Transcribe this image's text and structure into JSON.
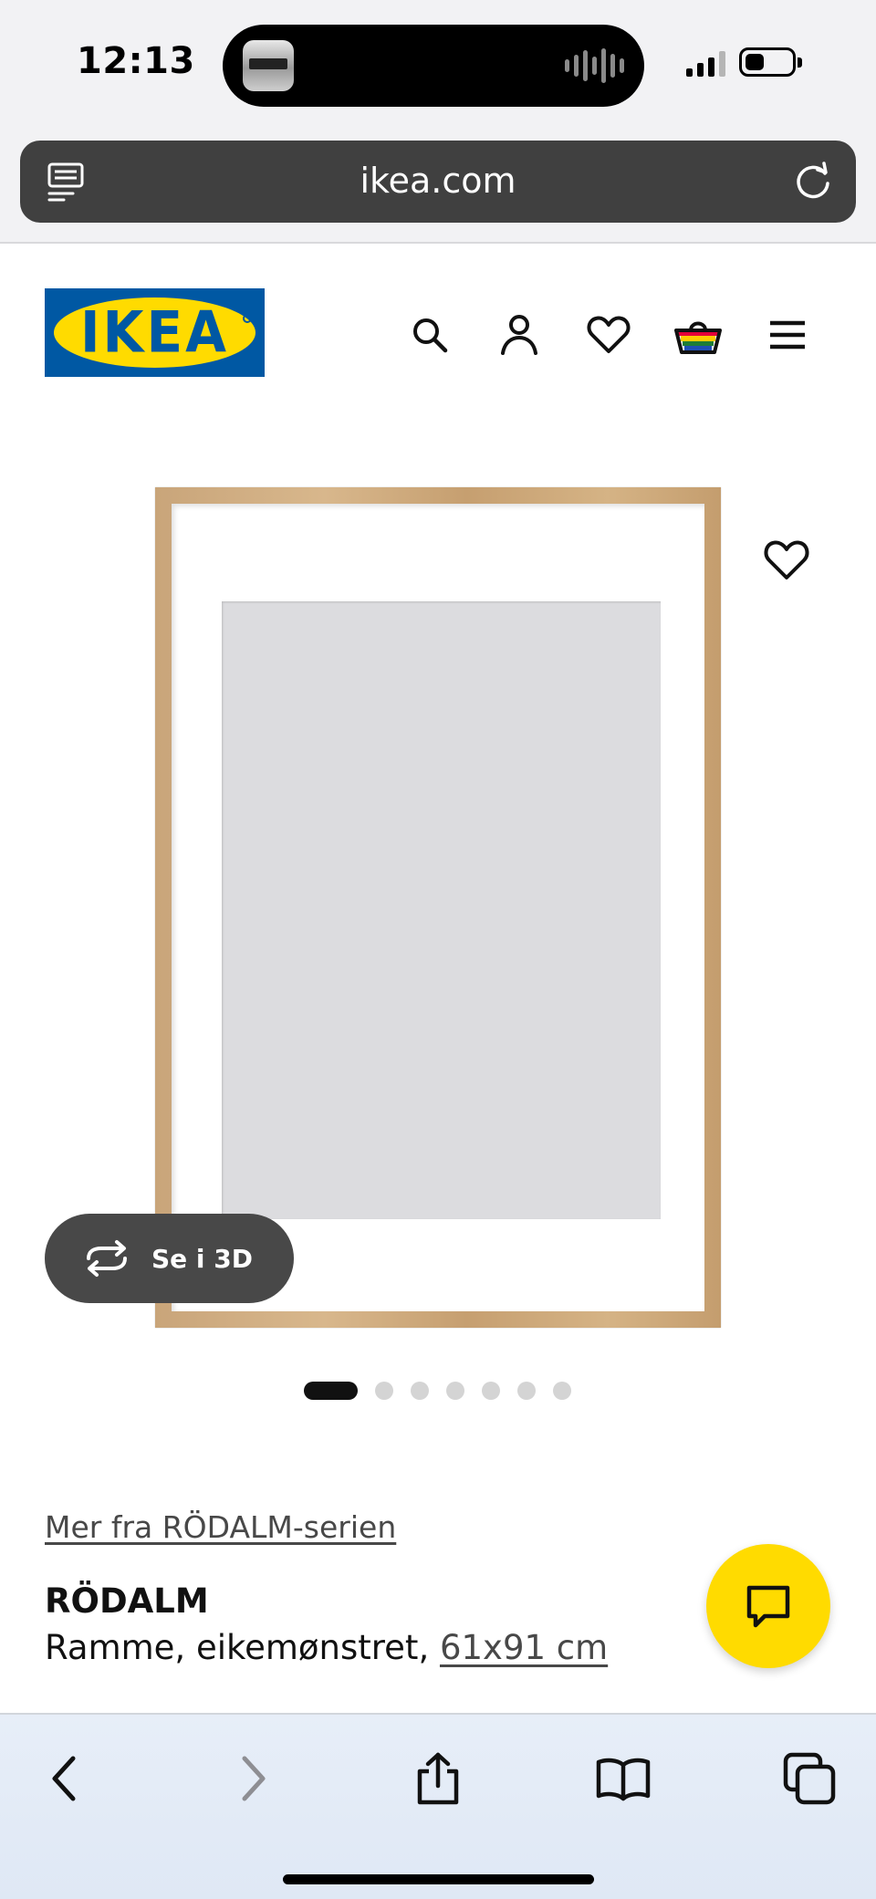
{
  "status_bar": {
    "time": "12:13",
    "battery_icon": "battery-icon",
    "signal_icon": "cellular-signal-icon"
  },
  "browser": {
    "url": "ikea.com",
    "reader_icon": "reader-mode-icon",
    "reload_icon": "reload-icon"
  },
  "header": {
    "logo_text": "IKEA",
    "icons": [
      "search-icon",
      "account-icon",
      "favourites-icon",
      "shopping-basket-icon",
      "menu-icon"
    ]
  },
  "product_image": {
    "favourite_icon": "heart-icon",
    "see_3d_label": "Se i 3D",
    "carousel": {
      "total": 7,
      "active_index": 0
    }
  },
  "product": {
    "series_link": "Mer fra RÖDALM-serien",
    "name": "RÖDALM",
    "description": "Ramme, eikemønstret,",
    "size_link": "61x91 cm"
  },
  "chat": {
    "icon": "chat-icon"
  },
  "toolbar": {
    "items": [
      "back-icon",
      "forward-icon",
      "share-icon",
      "bookmarks-icon",
      "tabs-icon"
    ]
  },
  "colors": {
    "ikea_blue": "#0058a3",
    "ikea_yellow": "#ffdb00",
    "dark_pill": "#484848",
    "url_bar": "#404040"
  }
}
